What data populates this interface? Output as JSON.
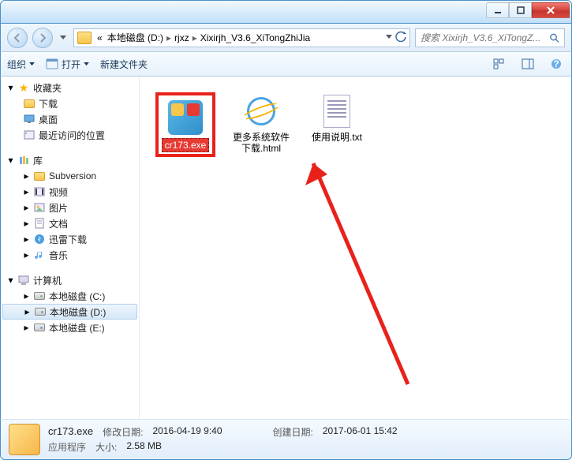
{
  "titlebar": {},
  "nav": {
    "breadcrumbs": [
      "«",
      "本地磁盘 (D:)",
      "rjxz",
      "Xixirjh_V3.6_XiTongZhiJia"
    ],
    "search_placeholder": "搜索 Xixirjh_V3.6_XiTongZ..."
  },
  "toolbar": {
    "organize": "组织",
    "open": "打开",
    "newfolder": "新建文件夹"
  },
  "sidebar": {
    "favorites": {
      "label": "收藏夹",
      "items": [
        "下载",
        "桌面",
        "最近访问的位置"
      ]
    },
    "libraries": {
      "label": "库",
      "items": [
        "Subversion",
        "视频",
        "图片",
        "文档",
        "迅雷下载",
        "音乐"
      ]
    },
    "computer": {
      "label": "计算机",
      "items": [
        "本地磁盘 (C:)",
        "本地磁盘 (D:)",
        "本地磁盘 (E:)"
      ]
    }
  },
  "files": [
    {
      "name": "cr173.exe"
    },
    {
      "name": "更多系统软件下载.html"
    },
    {
      "name": "使用说明.txt"
    }
  ],
  "details": {
    "filename": "cr173.exe",
    "type": "应用程序",
    "mod_label": "修改日期:",
    "mod_value": "2016-04-19 9:40",
    "size_label": "大小:",
    "size_value": "2.58 MB",
    "create_label": "创建日期:",
    "create_value": "2017-06-01 15:42"
  }
}
